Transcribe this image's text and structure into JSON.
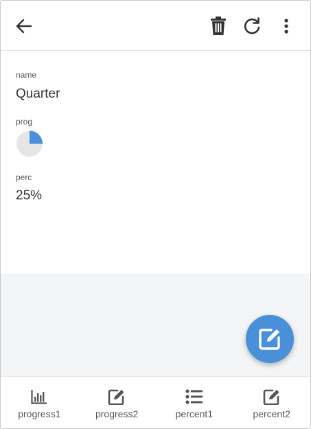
{
  "toolbar": {
    "back_icon": "arrow-left-icon",
    "delete_icon": "trash-icon",
    "refresh_icon": "refresh-icon",
    "more_icon": "more-vertical-icon"
  },
  "fields": {
    "name_label": "name",
    "name_value": "Quarter",
    "prog_label": "prog",
    "prog_fraction": 0.25,
    "perc_label": "perc",
    "perc_value": "25%"
  },
  "fab": {
    "icon": "edit-icon"
  },
  "bottom_nav": {
    "items": [
      {
        "label": "progress1",
        "icon": "bar-chart-icon"
      },
      {
        "label": "progress2",
        "icon": "edit-icon"
      },
      {
        "label": "percent1",
        "icon": "list-icon"
      },
      {
        "label": "percent2",
        "icon": "edit-icon"
      }
    ]
  },
  "colors": {
    "accent": "#4a90d9",
    "pie_background": "#e6e6e6",
    "icon": "#333333"
  }
}
